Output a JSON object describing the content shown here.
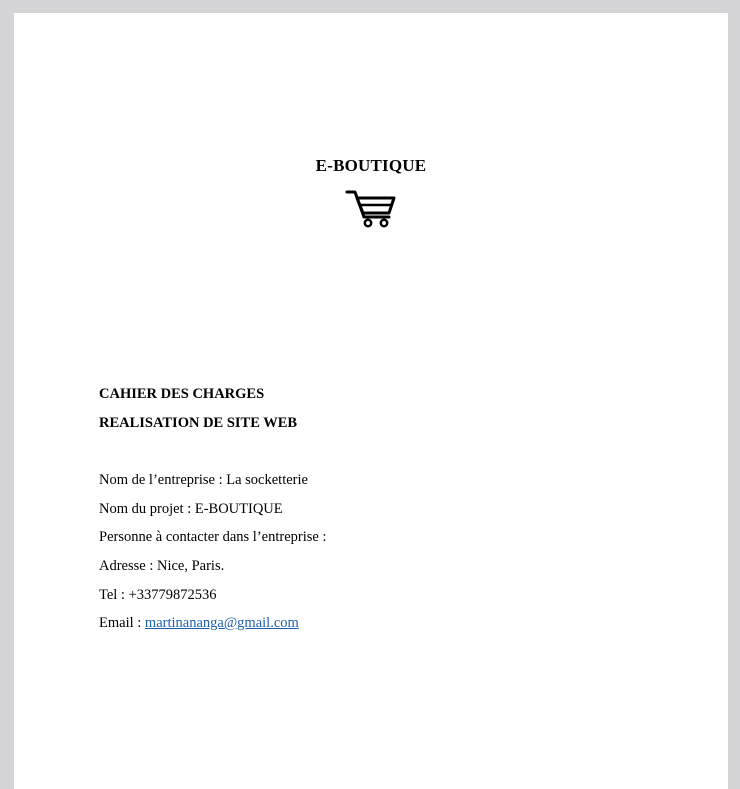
{
  "cover": {
    "title": "E-BOUTIQUE"
  },
  "heading": {
    "line1": "CAHIER DES CHARGES",
    "line2": "REALISATION DE SITE WEB"
  },
  "info": {
    "company": "Nom de l’entreprise : La socketterie",
    "project": "Nom du projet : E-BOUTIQUE",
    "contact": "Personne à contacter dans l’entreprise :",
    "address": "Adresse : Nice, Paris.",
    "phone": "Tel : +33779872536",
    "email_label": "Email : ",
    "email_value": "martinananga@gmail.com"
  },
  "colors": {
    "page_background": "#ffffff",
    "canvas_background": "#d4d4d6",
    "link": "#1f5fb0"
  },
  "icons": {
    "cover_icon": "shopping-cart-icon"
  }
}
